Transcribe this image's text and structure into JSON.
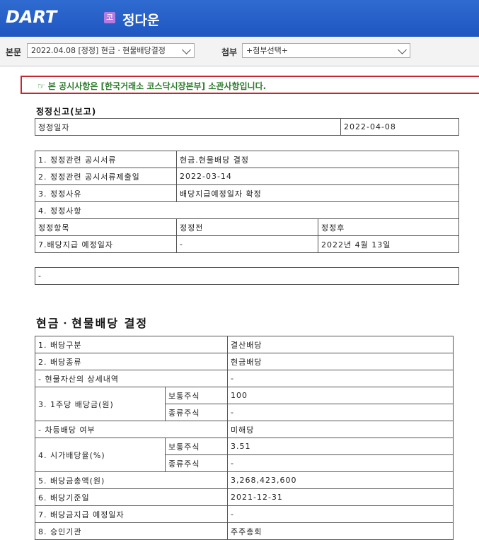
{
  "header": {
    "logo": "DART",
    "company_badge": "코",
    "company_name": "정다운"
  },
  "selectors": {
    "main_label": "본문",
    "main_value": "2022.04.08 [정정] 현금ㆍ현물배당결정",
    "attach_label": "첨부",
    "attach_value": "+첨부선택+"
  },
  "notice": "☞ 본 공시사항은 [한국거래소 코스닥시장본부] 소관사항입니다.",
  "correction": {
    "title": "정정신고(보고)",
    "date_label": "정정일자",
    "date_value": "2022-04-08",
    "rows": [
      {
        "label": "1. 정정관련 공시서류",
        "value": "현금.현물배당 결정"
      },
      {
        "label": "2. 정정관련 공시서류제출일",
        "value": "2022-03-14"
      },
      {
        "label": "3. 정정사유",
        "value": "배당지급예정일자 확정"
      }
    ],
    "items_label": "4. 정정사항",
    "col_item": "정정항목",
    "col_before": "정정전",
    "col_after": "정정후",
    "item_name": "7.배당지급 예정일자",
    "item_before": "-",
    "item_after": "2022년 4월 13일",
    "note": "-"
  },
  "dividend": {
    "title": "현금ㆍ현물배당 결정",
    "r1_label": "1. 배당구분",
    "r1_value": "결산배당",
    "r2_label": "2. 배당종류",
    "r2_value": "현금배당",
    "r3_label": "- 현물자산의 상세내역",
    "r3_value": "-",
    "r4_label": "3. 1주당 배당금(원)",
    "r4_sub1": "보통주식",
    "r4_val1": "100",
    "r4_sub2": "종류주식",
    "r4_val2": "-",
    "r5_label": "- 차등배당 여부",
    "r5_value": "미해당",
    "r6_label": "4. 시가배당율(%)",
    "r6_sub1": "보통주식",
    "r6_val1": "3.51",
    "r6_sub2": "종류주식",
    "r6_val2": "-",
    "r7_label": "5. 배당금총액(원)",
    "r7_value": "3,268,423,600",
    "r8_label": "6. 배당기준일",
    "r8_value": "2021-12-31",
    "r9_label": "7. 배당금지급 예정일자",
    "r9_value": "-",
    "r10_label": "8. 승인기관",
    "r10_value": "주주총회"
  }
}
